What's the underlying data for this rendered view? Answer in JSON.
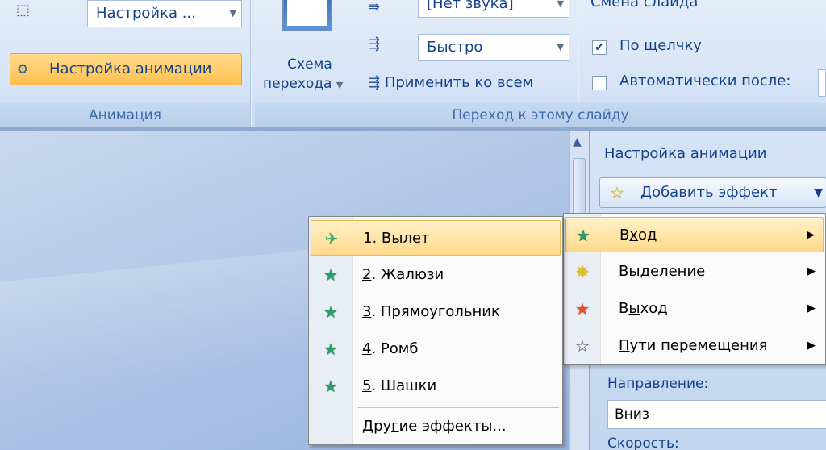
{
  "ribbon": {
    "animation_group": {
      "combo_value": "Настройка ...",
      "custom_animation_button": "Настройка анимации",
      "footer": "Анимация"
    },
    "transition_group": {
      "scheme_button_line1": "Схема",
      "scheme_button_line2": "перехода",
      "sound_combo": "[Нет звука]",
      "speed_combo": "Быстро",
      "apply_all": "Применить ко всем",
      "advance_title": "Смена слайда",
      "on_click": "По щелчку",
      "on_click_checked": true,
      "auto_after": "Автоматически после:",
      "auto_after_checked": false,
      "footer": "Переход к этому слайду"
    }
  },
  "task_pane": {
    "title": "Настройка анимации",
    "add_effect": "Добавить эффект",
    "direction_label": "Направление:",
    "direction_value": "Вниз",
    "speed_label": "Скорость:"
  },
  "add_effect_menu": [
    {
      "label": "Вход",
      "accel": "х",
      "icon": "entrance-star-icon",
      "highlighted": true
    },
    {
      "label": "Выделение",
      "accel": "В",
      "icon": "emphasis-star-icon",
      "highlighted": false
    },
    {
      "label": "Выход",
      "accel": "ы",
      "icon": "exit-star-icon",
      "highlighted": false
    },
    {
      "label": "Пути перемещения",
      "accel": "П",
      "icon": "motion-path-star-icon",
      "highlighted": false
    }
  ],
  "entrance_submenu": [
    {
      "number": "1",
      "label": ". Вылет",
      "icon": "fly-in-icon",
      "highlighted": true
    },
    {
      "number": "2",
      "label": ". Жалюзи",
      "icon": "blinds-icon",
      "highlighted": false
    },
    {
      "number": "3",
      "label": ". Прямоугольник",
      "icon": "box-icon",
      "highlighted": false
    },
    {
      "number": "4",
      "label": ". Ромб",
      "icon": "diamond-icon",
      "highlighted": false
    },
    {
      "number": "5",
      "label": ". Шашки",
      "icon": "checkerboard-icon",
      "highlighted": false
    },
    {
      "label_before": "Дру",
      "accel": "г",
      "label_after": "ие эффекты...",
      "icon": "none"
    }
  ]
}
